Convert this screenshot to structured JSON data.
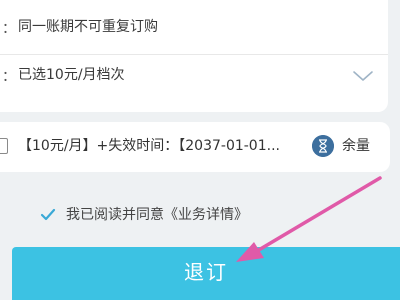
{
  "form": {
    "rule_text": "同一账期不可重复订购",
    "selected_plan": "已选10元/月档次",
    "dropdown_icon": "chevron-down-icon"
  },
  "order": {
    "price": "【10元/月】",
    "effective_label": "+失效时间：",
    "expiry_value": "【2037-01-01...",
    "remain_label": "余量",
    "remain_icon": "hourglass-icon"
  },
  "agreement": {
    "text": "我已阅读并同意《业务详情》",
    "checked": true,
    "icon": "check-icon"
  },
  "action": {
    "unsubscribe_label": "退订"
  },
  "colors": {
    "button": "#3cc2e3",
    "check": "#3aa9d6",
    "annotation_arrow": "#e05aa8",
    "hourglass_bg": "#3d6f9e"
  }
}
